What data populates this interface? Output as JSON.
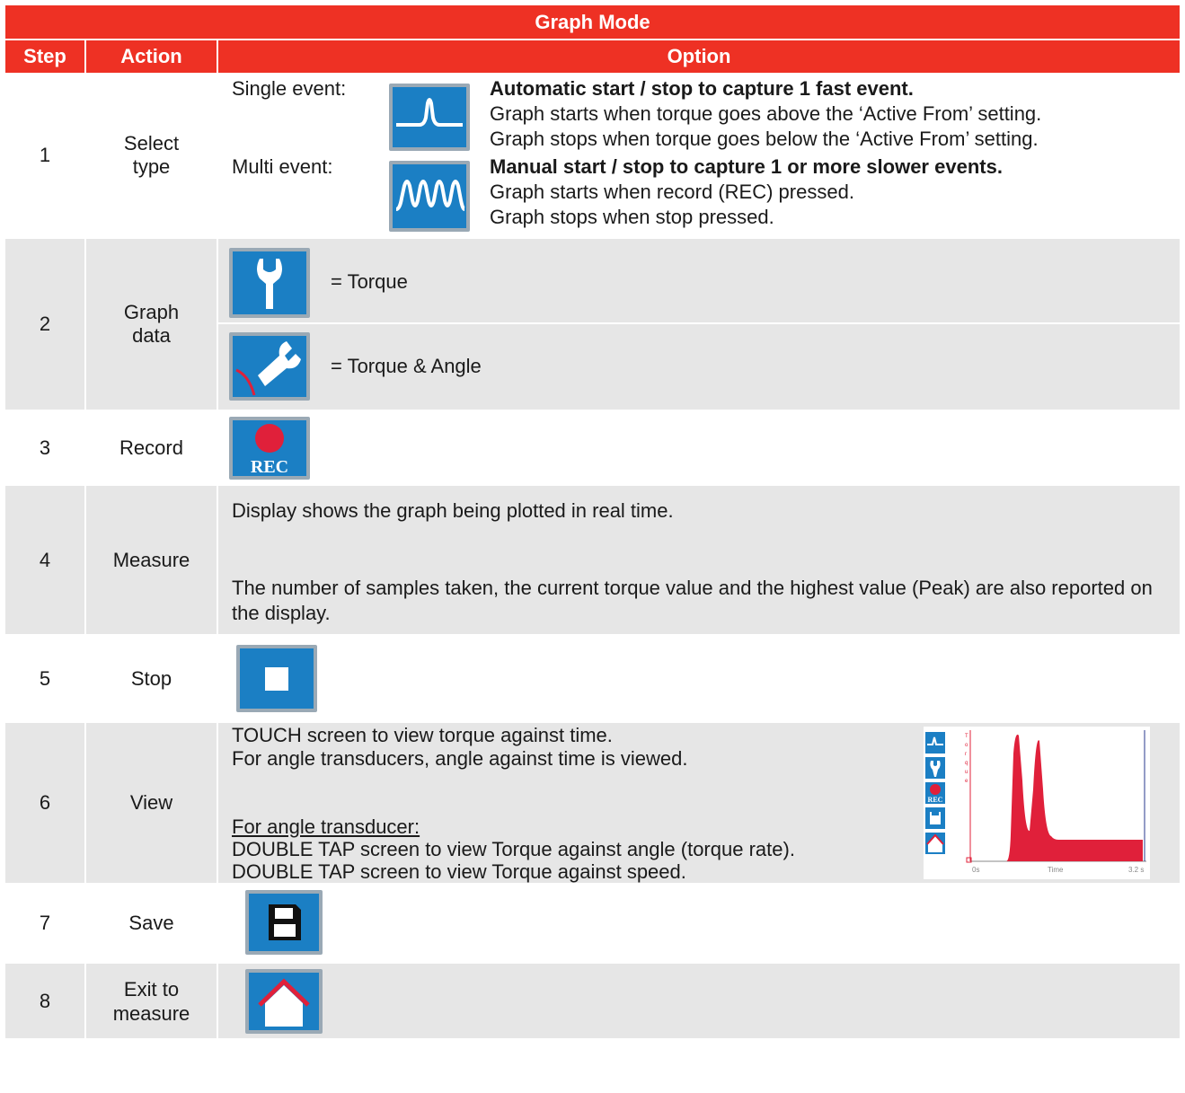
{
  "title": "Graph Mode",
  "headers": {
    "step": "Step",
    "action": "Action",
    "option": "Option"
  },
  "rows": [
    {
      "step": "1",
      "action": "Select type",
      "single_label": "Single event:",
      "single_title": "Automatic start / stop to capture 1 fast event.",
      "single_line1": "Graph starts when torque goes above the ‘Active From’ setting.",
      "single_line2": "Graph stops when torque goes below the ‘Active From’ setting.",
      "multi_label": "Multi event:",
      "multi_title": "Manual start / stop to capture 1 or more slower events.",
      "multi_line1": "Graph starts when record (REC) pressed.",
      "multi_line2": "Graph stops when stop pressed."
    },
    {
      "step": "2",
      "action": "Graph data",
      "torque": "= Torque",
      "torque_angle": "= Torque & Angle"
    },
    {
      "step": "3",
      "action": "Record",
      "rec_label": "REC"
    },
    {
      "step": "4",
      "action": "Measure",
      "line1": "Display shows the graph being plotted in real time.",
      "line2": "The number of samples taken, the current torque value and the highest value (Peak) are also reported on the display."
    },
    {
      "step": "5",
      "action": "Stop"
    },
    {
      "step": "6",
      "action": "View",
      "line1": "TOUCH screen to view torque against time.",
      "line2": "For angle transducers, angle against time is viewed.",
      "line3": "For angle transducer:",
      "line4": "DOUBLE TAP screen to view Torque against angle (torque rate).",
      "line5": "DOUBLE TAP screen to view Torque against speed.",
      "screen": {
        "x_start": "0s",
        "x_label": "Time",
        "x_end": "3.2 s",
        "rec": "REC"
      }
    },
    {
      "step": "7",
      "action": "Save"
    },
    {
      "step": "8",
      "action": "Exit to measure"
    }
  ],
  "colors": {
    "header": "#ee3124",
    "icon_blue": "#1b7fc4",
    "row_grey": "#e6e6e6",
    "graph_red": "#e0203a"
  }
}
